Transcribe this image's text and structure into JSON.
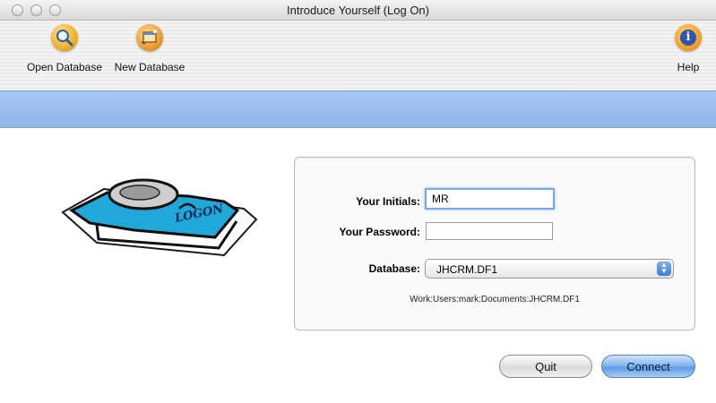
{
  "window": {
    "title": "Introduce Yourself (Log On)"
  },
  "toolbar": {
    "open_database": {
      "label": "Open Database",
      "icon": "magnifier-icon"
    },
    "new_database": {
      "label": "New Database",
      "icon": "new-database-icon"
    },
    "help": {
      "label": "Help",
      "icon": "info-icon"
    }
  },
  "illustration": {
    "caption": "LOGON",
    "icon": "logon-card-icon"
  },
  "form": {
    "initials_label": "Your Initials:",
    "initials_value": "MR",
    "password_label": "Your Password:",
    "password_value": "",
    "database_label": "Database:",
    "database_value": "JHCRM.DF1",
    "database_path": "Work:Users:mark:Documents:JHCRM.DF1"
  },
  "buttons": {
    "quit": "Quit",
    "connect": "Connect"
  },
  "colors": {
    "band": "#9dbff0",
    "accent": "#5d9ae6"
  }
}
